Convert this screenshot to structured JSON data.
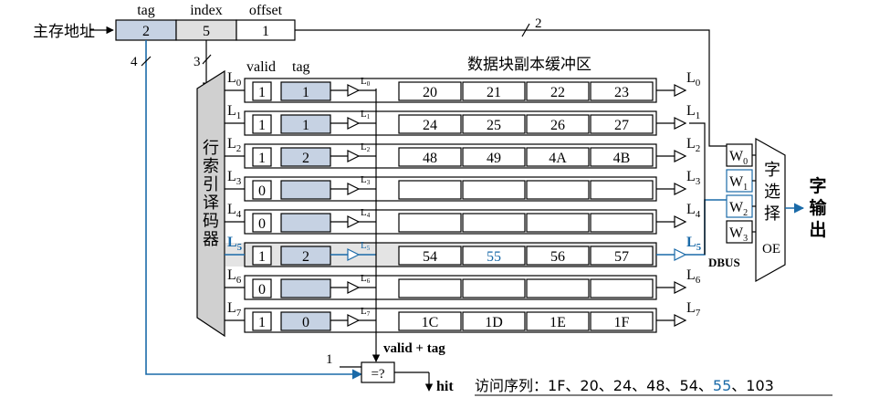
{
  "address": {
    "label": "主存地址",
    "field_headers": [
      "tag",
      "index",
      "offset"
    ],
    "field_values": [
      "2",
      "5",
      "1"
    ],
    "width_markers": {
      "tag": "4",
      "index": "3",
      "offset": "2"
    }
  },
  "decoder": {
    "label": "行索引译码器"
  },
  "headers": {
    "valid": "valid",
    "tag": "tag",
    "data": "数据块副本缓冲区"
  },
  "lines": [
    {
      "label": "L",
      "sub": "0",
      "valid": "1",
      "tag": "1",
      "words": [
        "20",
        "21",
        "22",
        "23"
      ],
      "highlight": false
    },
    {
      "label": "L",
      "sub": "1",
      "valid": "1",
      "tag": "1",
      "words": [
        "24",
        "25",
        "26",
        "27"
      ],
      "highlight": false
    },
    {
      "label": "L",
      "sub": "2",
      "valid": "1",
      "tag": "2",
      "words": [
        "48",
        "49",
        "4A",
        "4B"
      ],
      "highlight": false
    },
    {
      "label": "L",
      "sub": "3",
      "valid": "0",
      "tag": "",
      "words": [
        "",
        "",
        "",
        ""
      ],
      "highlight": false
    },
    {
      "label": "L",
      "sub": "4",
      "valid": "0",
      "tag": "",
      "words": [
        "",
        "",
        "",
        ""
      ],
      "highlight": false
    },
    {
      "label": "L",
      "sub": "5",
      "valid": "1",
      "tag": "2",
      "words": [
        "54",
        "55",
        "56",
        "57"
      ],
      "highlight": true
    },
    {
      "label": "L",
      "sub": "6",
      "valid": "0",
      "tag": "",
      "words": [
        "",
        "",
        "",
        ""
      ],
      "highlight": false
    },
    {
      "label": "L",
      "sub": "7",
      "valid": "1",
      "tag": "0",
      "words": [
        "1C",
        "1D",
        "1E",
        "1F"
      ],
      "highlight": false
    }
  ],
  "word_select": {
    "words": [
      {
        "w": "W",
        "sub": "0"
      },
      {
        "w": "W",
        "sub": "1"
      },
      {
        "w": "W",
        "sub": "2"
      },
      {
        "w": "W",
        "sub": "3"
      }
    ],
    "label": [
      "字",
      "选",
      "择"
    ],
    "oe": "OE",
    "dbus": "DBUS",
    "output": [
      "字",
      "输",
      "出"
    ]
  },
  "compare": {
    "symbol": "=?",
    "one": "1",
    "valid_tag": "valid + tag",
    "hit": "hit"
  },
  "sequence": {
    "label": "访问序列：",
    "items": [
      "1F",
      "20",
      "24",
      "48",
      "54",
      "55",
      "103"
    ],
    "highlight_index": 5,
    "separator": "、"
  },
  "colors": {
    "accent": "#1a6aa8",
    "fill": "#c6d2e3",
    "row_highlight": "#e4e4e4",
    "decoder_fill": "#d0d0d0"
  }
}
